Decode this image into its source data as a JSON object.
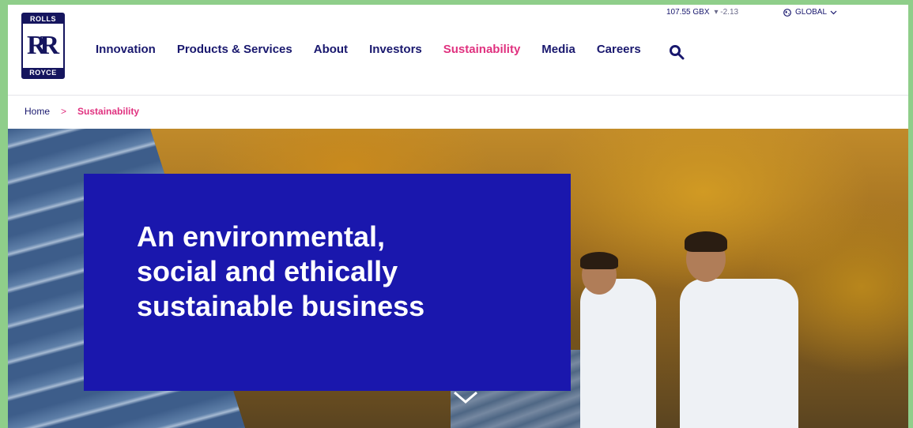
{
  "header": {
    "logo": {
      "top_word": "ROLLS",
      "monogram": "RR",
      "bottom_word": "ROYCE"
    },
    "stock": {
      "price": "107.55 GBX",
      "change": "▾ -2.13"
    },
    "region": {
      "label": "GLOBAL"
    },
    "nav": [
      {
        "label": "Innovation"
      },
      {
        "label": "Products & Services"
      },
      {
        "label": "About"
      },
      {
        "label": "Investors"
      },
      {
        "label": "Sustainability",
        "active": true
      },
      {
        "label": "Media"
      },
      {
        "label": "Careers"
      }
    ]
  },
  "breadcrumb": {
    "home": "Home",
    "separator": ">",
    "current": "Sustainability"
  },
  "hero": {
    "title_line1": "An environmental,",
    "title_line2": "social and ethically",
    "title_line3": "sustainable business"
  },
  "colors": {
    "brand_navy": "#19186e",
    "accent_pink": "#e0317f",
    "hero_blue": "#1a17ad"
  },
  "icons": [
    "search-icon",
    "globe-icon",
    "chevron-down-icon",
    "scroll-down-chevron-icon"
  ]
}
